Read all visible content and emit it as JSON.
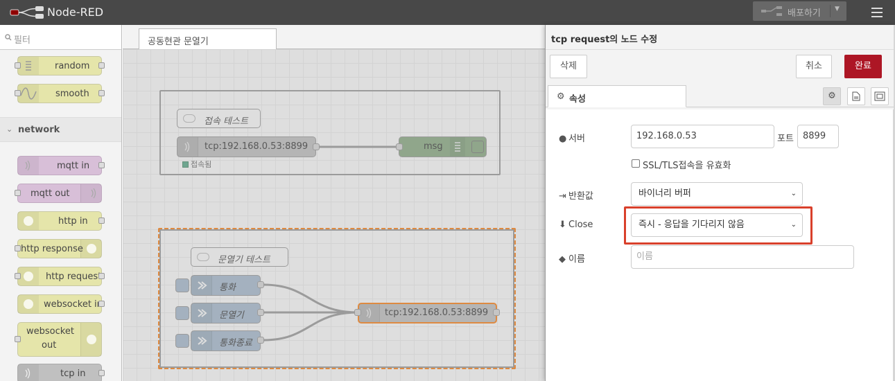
{
  "header": {
    "app_title": "Node-RED",
    "deploy_label": "배포하기",
    "icons": [
      "node-red-logo-icon",
      "deploy-icon",
      "chevron-down-icon",
      "hamburger-menu-icon"
    ]
  },
  "palette": {
    "search_placeholder": "필터",
    "category": "network",
    "nodes_top": [
      {
        "label": "random",
        "icon": "random-icon"
      },
      {
        "label": "smooth",
        "icon": "smooth-wave-icon"
      }
    ],
    "nodes_network": [
      {
        "label": "mqtt in",
        "icon": "mqtt-icon"
      },
      {
        "label": "mqtt out",
        "icon": "mqtt-icon"
      },
      {
        "label": "http in",
        "icon": "globe-icon"
      },
      {
        "label": "http response",
        "icon": "globe-icon"
      },
      {
        "label": "http request",
        "icon": "globe-icon"
      },
      {
        "label": "websocket in",
        "icon": "globe-icon"
      },
      {
        "label_line1": "websocket",
        "label_line2": "out",
        "icon": "globe-icon"
      },
      {
        "label": "tcp in",
        "icon": "bridge-icon"
      }
    ]
  },
  "workspace": {
    "tab_label": "공동현관 문열기",
    "group1": {
      "comment": "접속 테스트",
      "tcp_node": "tcp:192.168.0.53:8899",
      "status": "접속됨",
      "debug_node": "msg"
    },
    "group2": {
      "comment": "문열기 테스트",
      "inject1": "통화",
      "inject2": "문열기",
      "inject3": "통화종료",
      "tcp_request": "tcp:192.168.0.53:8899"
    },
    "colors": {
      "selected_border": "#ff7f0e",
      "debug_node": "#87a980",
      "inject_node": "#a6bbcf",
      "tcp_node": "#c0c0c0"
    }
  },
  "editor": {
    "title": "tcp request의 노드 수정",
    "delete_button": "삭제",
    "cancel_button": "취소",
    "done_button": "완료",
    "tab_properties": "속성",
    "server_label": "서버",
    "server_value": "192.168.0.53",
    "port_label": "포트",
    "port_value": "8899",
    "tls_label": "SSL/TLS접속을 유효화",
    "return_label": "반환값",
    "return_value": "바이너리 버퍼",
    "close_label": "Close",
    "close_value": "즉시 - 응답을 기다리지 않음",
    "name_label": "이름",
    "name_placeholder": "이름",
    "highlight_color": "#d9402b",
    "primary_color": "#ad1625"
  }
}
